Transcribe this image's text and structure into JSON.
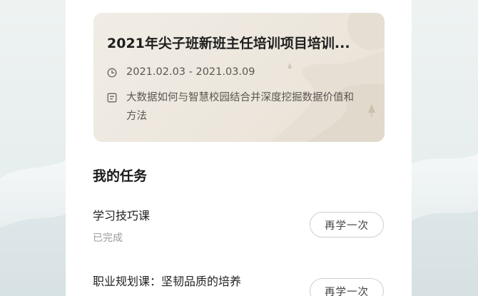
{
  "course_card": {
    "title": "2021年尖子班新班主任培训项目培训...",
    "date_range": "2021.02.03 - 2021.03.09",
    "topic": "大数据如何与智慧校园结合并深度挖掘数据价值和方法",
    "clock_icon": "clock-icon",
    "topic_icon": "document-icon"
  },
  "tasks_section": {
    "title": "我的任务",
    "items": [
      {
        "name": "学习技巧课",
        "status": "已完成",
        "button_label": "再学一次"
      },
      {
        "name": "职业规划课：坚韧品质的培养",
        "status": "",
        "button_label": "再学一次"
      }
    ]
  },
  "colors": {
    "background": "#e7eeee",
    "card": "#ece6dc",
    "title_text": "#1e1e1e",
    "muted_text": "#9a9a9a",
    "button_border": "#cfcfcf"
  }
}
